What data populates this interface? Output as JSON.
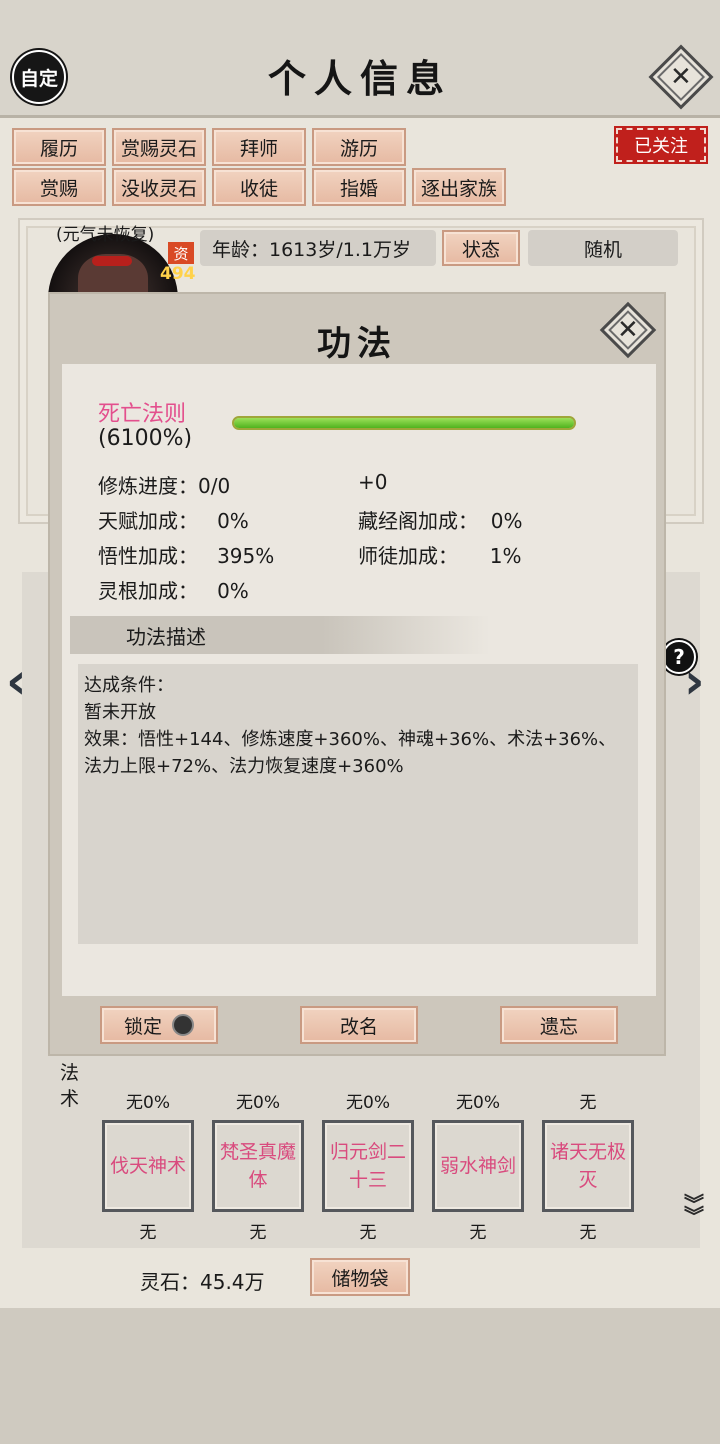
{
  "header": {
    "title": "个人信息",
    "custom_label": "自定",
    "close_glyph": "✕"
  },
  "actions_row1": [
    "履历",
    "赏赐灵石",
    "拜师",
    "游历"
  ],
  "actions_row2": [
    "赏赐",
    "没收灵石",
    "收徒",
    "指婚",
    "逐出家族"
  ],
  "follow_badge": "已关注",
  "profile": {
    "status_tag": "(元气未恢复)",
    "zi_label": "资",
    "zi_value": "494",
    "age_label": "年龄：1613岁/1.1万岁",
    "state_button": "状态",
    "random_button": "随机"
  },
  "dialog": {
    "title": "功法",
    "close_glyph": "✕",
    "skill_name": "死亡法则",
    "skill_percent": "(6100%)",
    "progress_fraction": 1.0,
    "stats": {
      "cultivation_progress": "修炼进度：0/0",
      "cultivation_bonus": "+0",
      "talent": "天赋加成：   0%",
      "library": "藏经阁加成：  0%",
      "insight": "悟性加成：   395%",
      "master": "师徒加成：     1%",
      "root": "灵根加成：   0%"
    },
    "desc_header": "功法描述",
    "desc_lines": [
      "达成条件：",
      "暂未开放",
      "效果：悟性+144、修炼速度+360%、神魂+36%、术法+36%、",
      "法力上限+72%、法力恢复速度+360%"
    ],
    "buttons": {
      "lock": "锁定",
      "rename": "改名",
      "forget": "遗忘"
    }
  },
  "fashu_label": "法术",
  "row1_captions": [
    "无0%",
    "无0%",
    "无0%",
    "无0%",
    "无"
  ],
  "skills_row2": [
    {
      "name": "伐天神术",
      "caption": "无"
    },
    {
      "name": "梵圣真魔体",
      "caption": "无"
    },
    {
      "name": "归元剑二十三",
      "caption": "无"
    },
    {
      "name": "弱水神剑",
      "caption": "无"
    },
    {
      "name": "诸天无极灭",
      "caption": "无"
    }
  ],
  "footer": {
    "spirit_stone": "灵石：45.4万",
    "storage_button": "储物袋"
  },
  "colors": {
    "skill_pink": "#e34f8d",
    "follow_red": "#c0201c",
    "progress_green": "#4fb31e",
    "button_tan": "#e6b9a2"
  },
  "icons": [
    "close-icon",
    "help-icon",
    "left-arrow-icon",
    "right-arrow-icon",
    "double-chevron-down-icon",
    "lock-toggle-icon"
  ]
}
